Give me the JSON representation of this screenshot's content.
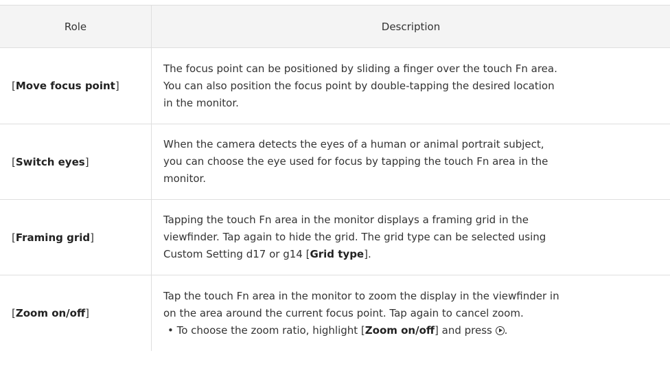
{
  "table": {
    "headers": {
      "role": "Role",
      "description": "Description"
    },
    "rows": [
      {
        "open": "[",
        "role": "Move focus point",
        "close": "]",
        "lines": [
          "The focus point can be positioned by sliding a finger over the touch Fn area.",
          "You can also position the focus point by double-tapping the desired location",
          "in the monitor."
        ]
      },
      {
        "open": "[",
        "role": "Switch eyes",
        "close": "]",
        "lines": [
          "When the camera detects the eyes of a human or animal portrait subject,",
          "you can choose the eye used for focus by tapping the touch Fn area in the",
          "monitor."
        ]
      },
      {
        "open": "[",
        "role": "Framing grid",
        "close": "]",
        "lines": [
          "Tapping the touch Fn area in the monitor displays a framing grid in the",
          "viewfinder. Tap again to hide the grid. The grid type can be selected using"
        ],
        "line3_prefix": "Custom Setting d17 or g14 [",
        "line3_bold": "Grid type",
        "line3_suffix": "]."
      },
      {
        "open": "[",
        "role": "Zoom on/off",
        "close": "]",
        "lines": [
          "Tap the touch Fn area in the monitor to zoom the display in the viewfinder in",
          "on the area around the current focus point. Tap again to cancel zoom."
        ],
        "bullet_prefix": "• To choose the zoom ratio, highlight [",
        "bullet_bold": "Zoom on/off",
        "bullet_mid": "] and press ",
        "bullet_icon": "multi-selector-right-icon",
        "bullet_suffix": "."
      }
    ]
  }
}
